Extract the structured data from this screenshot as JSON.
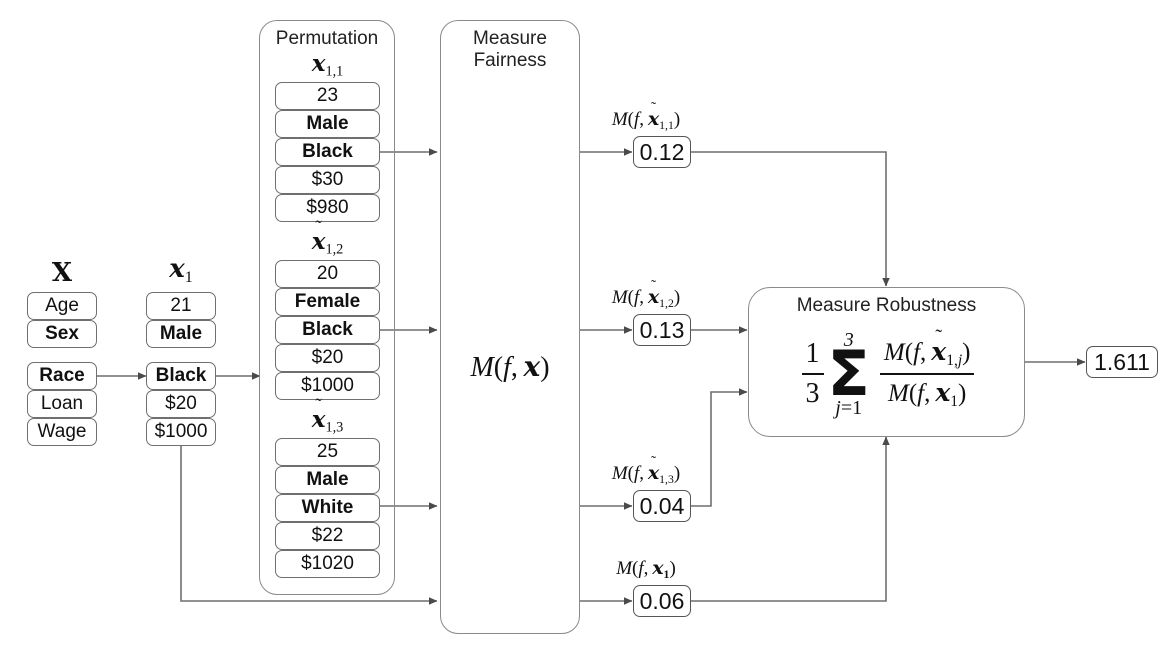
{
  "diagram": {
    "title": "Fairness and robustness measurement pipeline",
    "stroke_color": "#6f6f6f",
    "panel_stroke_color": "#8a8a8a",
    "background": "#ffffff"
  },
  "feature_matrix": {
    "header": "X",
    "cells": [
      {
        "label": "Age",
        "bold": false
      },
      {
        "label": "Sex",
        "bold": true
      },
      {
        "label": "Race",
        "bold": true
      },
      {
        "label": "Loan",
        "bold": false
      },
      {
        "label": "Wage",
        "bold": false
      }
    ]
  },
  "instance": {
    "header_base": "x",
    "header_sub": "1",
    "cells": [
      {
        "label": "21",
        "bold": false
      },
      {
        "label": "Male",
        "bold": true
      },
      {
        "label": "Black",
        "bold": true
      },
      {
        "label": "$20",
        "bold": false
      },
      {
        "label": "$1000",
        "bold": false
      }
    ]
  },
  "permutation_panel": {
    "title": "Permutation",
    "columns": [
      {
        "header_tilde": false,
        "header_base": "x",
        "header_sub": "1,1",
        "cells": [
          {
            "label": "23",
            "bold": false
          },
          {
            "label": "Male",
            "bold": true
          },
          {
            "label": "Black",
            "bold": true
          },
          {
            "label": "$30",
            "bold": false
          },
          {
            "label": "$980",
            "bold": false
          }
        ]
      },
      {
        "header_tilde": true,
        "header_base": "x",
        "header_sub": "1,2",
        "cells": [
          {
            "label": "20",
            "bold": false
          },
          {
            "label": "Female",
            "bold": true
          },
          {
            "label": "Black",
            "bold": true
          },
          {
            "label": "$20",
            "bold": false
          },
          {
            "label": "$1000",
            "bold": false
          }
        ]
      },
      {
        "header_tilde": true,
        "header_base": "x",
        "header_sub": "1,3",
        "cells": [
          {
            "label": "25",
            "bold": false
          },
          {
            "label": "Male",
            "bold": true
          },
          {
            "label": "White",
            "bold": true
          },
          {
            "label": "$22",
            "bold": false
          },
          {
            "label": "$1020",
            "bold": false
          }
        ]
      }
    ]
  },
  "fairness_panel": {
    "title_line1": "Measure",
    "title_line2": "Fairness",
    "formula_text": "M(f, x)"
  },
  "fairness_outputs": [
    {
      "label_text": "M(f, x̃1,1)",
      "value": "0.12",
      "sub": "1,1",
      "tilde": true,
      "bold_sub": false
    },
    {
      "label_text": "M(f, x̃1,2)",
      "value": "0.13",
      "sub": "1,2",
      "tilde": true,
      "bold_sub": false
    },
    {
      "label_text": "M(f, x̃1,3)",
      "value": "0.04",
      "sub": "1,3",
      "tilde": true,
      "bold_sub": false
    },
    {
      "label_text": "M(f, x1)",
      "value": "0.06",
      "sub": "1",
      "tilde": false,
      "bold_sub": true
    }
  ],
  "robustness_panel": {
    "title": "Measure Robustness",
    "fraction_coefficient_num": "1",
    "fraction_coefficient_den": "3",
    "sum_upper": "3",
    "sum_lower": "j=1",
    "numerator_text": "M(f, x̃1,j)",
    "denominator_text": "M(f, x1)"
  },
  "final_output": {
    "value": "1.611"
  }
}
